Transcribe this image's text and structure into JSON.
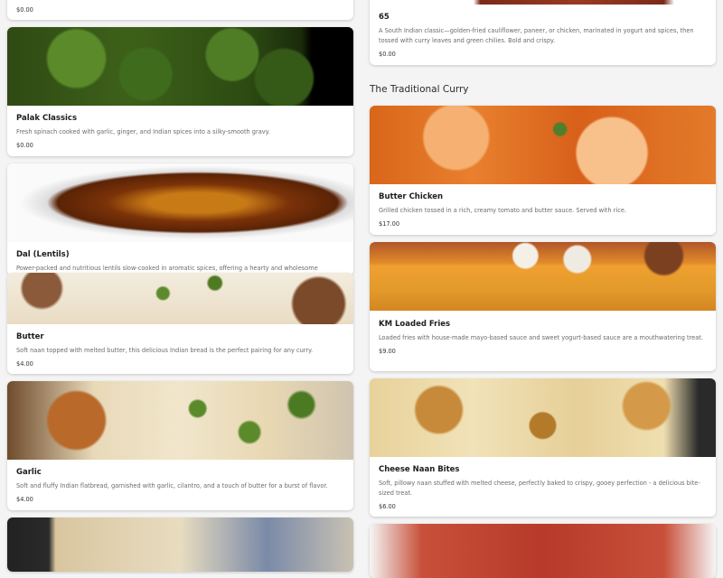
{
  "left_column": [
    {
      "price": "$0.00"
    },
    {
      "name": "Palak Classics",
      "description": "Fresh spinach cooked with garlic, ginger, and Indian spices into a silky-smooth gravy.",
      "price": "$0.00"
    },
    {
      "name": "Dal (Lentils)",
      "description": "Power-packed and nutritious lentils slow-cooked in aromatic spices, offering a hearty and wholesome"
    },
    {
      "name": "Butter",
      "description": "Soft naan topped with melted butter, this delicious Indian bread is the perfect pairing for any curry.",
      "price": "$4.00"
    },
    {
      "name": "Garlic",
      "description": "Soft and fluffy Indian flatbread, garnished with garlic, cilantro, and a touch of butter for a burst of flavor.",
      "price": "$4.00"
    }
  ],
  "right_column": {
    "top_item": {
      "name": "65",
      "description": "A South Indian classic—golden-fried cauliflower, paneer, or chicken, marinated in yogurt and spices, then tossed with curry leaves and green chilies. Bold and crispy.",
      "price": "$0.00"
    },
    "section_title": "The Traditional Curry",
    "items": [
      {
        "name": "Butter Chicken",
        "description": "Grilled chicken tossed in a rich, creamy tomato and butter sauce. Served with rice.",
        "price": "$17.00"
      },
      {
        "name": "KM Loaded Fries",
        "description": "Loaded fries with house-made mayo-based sauce and sweet yogurt-based sauce are a mouthwatering treat.",
        "price": "$9.00"
      },
      {
        "name": "Cheese Naan Bites",
        "description": "Soft, pillowy naan stuffed with melted cheese, perfectly baked to crispy, gooey perfection - a delicious bite-sized treat.",
        "price": "$6.00"
      }
    ]
  }
}
